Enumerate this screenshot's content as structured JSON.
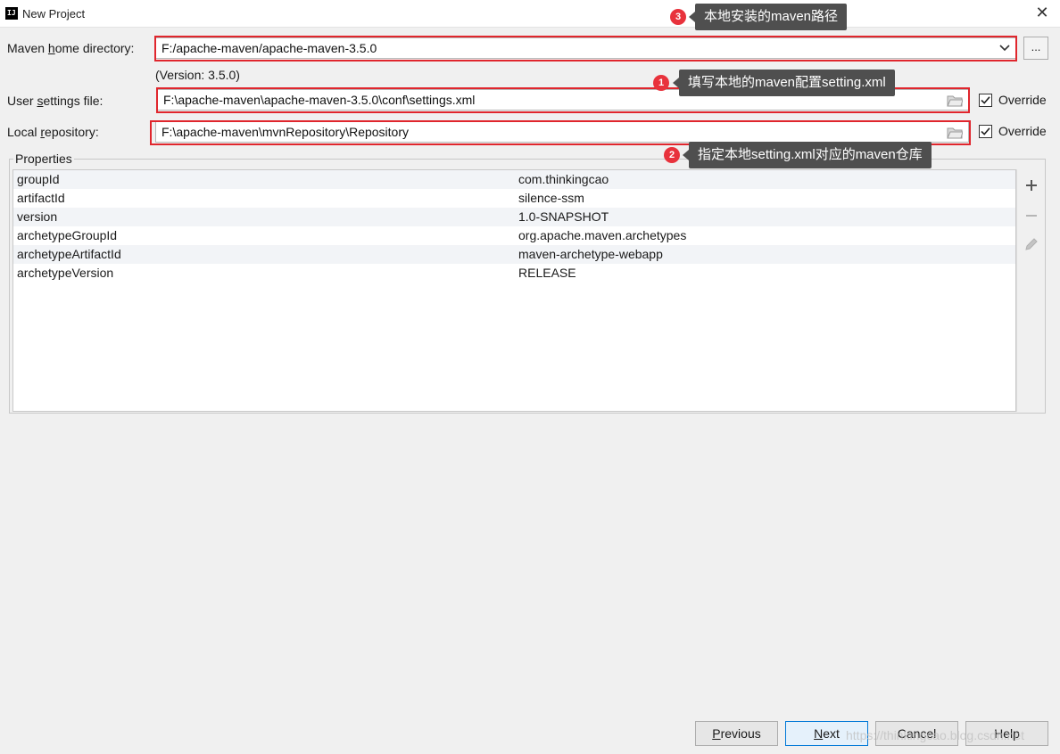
{
  "window": {
    "title": "New Project",
    "icon_text": "IJ"
  },
  "maven_home": {
    "label_pre": "Maven ",
    "label_mnemonic": "h",
    "label_post": "ome directory:",
    "value": "F:/apache-maven/apache-maven-3.5.0",
    "browse_label": "...",
    "version_note": "(Version: 3.5.0)"
  },
  "user_settings": {
    "label_pre": "User ",
    "label_mnemonic": "s",
    "label_post": "ettings file:",
    "value": "F:\\apache-maven\\apache-maven-3.5.0\\conf\\settings.xml",
    "override_label": "Override",
    "override_checked": true
  },
  "local_repo": {
    "label_pre": "Local ",
    "label_mnemonic": "r",
    "label_post": "epository:",
    "value": "F:\\apache-maven\\mvnRepository\\Repository",
    "override_label": "Override",
    "override_checked": true
  },
  "properties": {
    "legend": "Properties",
    "rows": [
      {
        "key": "groupId",
        "value": "com.thinkingcao"
      },
      {
        "key": "artifactId",
        "value": "silence-ssm"
      },
      {
        "key": "version",
        "value": "1.0-SNAPSHOT"
      },
      {
        "key": "archetypeGroupId",
        "value": "org.apache.maven.archetypes"
      },
      {
        "key": "archetypeArtifactId",
        "value": "maven-archetype-webapp"
      },
      {
        "key": "archetypeVersion",
        "value": "RELEASE"
      }
    ],
    "tools": [
      "plus-icon",
      "minus-icon",
      "pencil-icon"
    ]
  },
  "annotations": [
    {
      "number": "3",
      "text": "本地安装的maven路径"
    },
    {
      "number": "1",
      "text": "填写本地的maven配置setting.xml"
    },
    {
      "number": "2",
      "text": "指定本地setting.xml对应的maven仓库"
    }
  ],
  "buttons": {
    "previous_mnemonic": "P",
    "previous_rest": "revious",
    "next_mnemonic": "N",
    "next_rest": "ext",
    "cancel": "Cancel",
    "help": "Help"
  },
  "watermark": "https://thinkingcao.blog.csdn.net",
  "colors": {
    "annotation_red": "#e0262d",
    "callout_bg": "#4f4f4f",
    "badge_red": "#e8323c",
    "primary_border": "#0078d7"
  }
}
